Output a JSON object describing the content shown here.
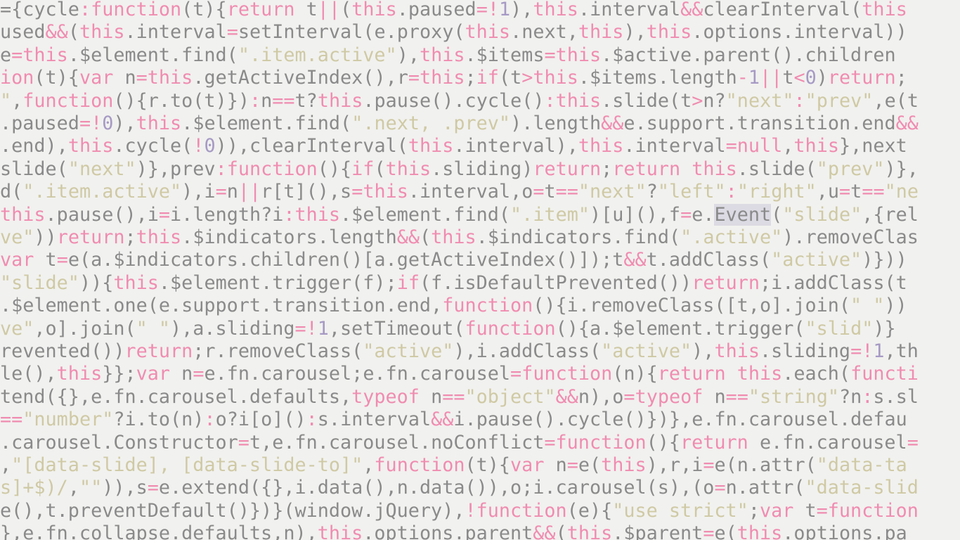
{
  "colors": {
    "background": "#f1f1ef",
    "plain": "#8a8a8a",
    "keyword": "#f08cb0",
    "string": "#cfc9a4",
    "number": "#a69ac4",
    "highlight": "#dcdae3"
  },
  "lines": [
    [
      [
        "p",
        "={cycle"
      ],
      [
        "k",
        ":function"
      ],
      [
        "p",
        "(t){"
      ],
      [
        "k",
        "return"
      ],
      [
        "p",
        " t"
      ],
      [
        "k",
        "||"
      ],
      [
        "p",
        "("
      ],
      [
        "k",
        "this"
      ],
      [
        "p",
        ".paused"
      ],
      [
        "k",
        "=!"
      ],
      [
        "n",
        "1"
      ],
      [
        "p",
        "),"
      ],
      [
        "k",
        "this"
      ],
      [
        "p",
        ".interval"
      ],
      [
        "k",
        "&&"
      ],
      [
        "p",
        "clearInterval("
      ],
      [
        "k",
        "this"
      ]
    ],
    [
      [
        "p",
        "used"
      ],
      [
        "k",
        "&&"
      ],
      [
        "p",
        "("
      ],
      [
        "k",
        "this"
      ],
      [
        "p",
        ".interval"
      ],
      [
        "k",
        "="
      ],
      [
        "p",
        "setInterval(e.proxy("
      ],
      [
        "k",
        "this"
      ],
      [
        "p",
        ".next,"
      ],
      [
        "k",
        "this"
      ],
      [
        "p",
        "),"
      ],
      [
        "k",
        "this"
      ],
      [
        "p",
        ".options.interval))"
      ]
    ],
    [
      [
        "p",
        "e"
      ],
      [
        "k",
        "=this"
      ],
      [
        "p",
        ".$element.find("
      ],
      [
        "s",
        "\".item.active\""
      ],
      [
        "p",
        "),"
      ],
      [
        "k",
        "this"
      ],
      [
        "p",
        ".$items"
      ],
      [
        "k",
        "=this"
      ],
      [
        "p",
        ".$active.parent().children"
      ]
    ],
    [
      [
        "k",
        "ion"
      ],
      [
        "p",
        "(t){"
      ],
      [
        "k",
        "var"
      ],
      [
        "p",
        " n"
      ],
      [
        "k",
        "=this"
      ],
      [
        "p",
        ".getActiveIndex(),r"
      ],
      [
        "k",
        "=this"
      ],
      [
        "p",
        ";"
      ],
      [
        "k",
        "if"
      ],
      [
        "p",
        "(t"
      ],
      [
        "k",
        ">this"
      ],
      [
        "p",
        ".$items.length"
      ],
      [
        "k",
        "-"
      ],
      [
        "n",
        "1"
      ],
      [
        "k",
        "||"
      ],
      [
        "p",
        "t"
      ],
      [
        "k",
        "<"
      ],
      [
        "n",
        "0"
      ],
      [
        "p",
        ")"
      ],
      [
        "k",
        "return"
      ],
      [
        "p",
        ";"
      ]
    ],
    [
      [
        "s",
        "\""
      ],
      [
        "p",
        ","
      ],
      [
        "k",
        "function"
      ],
      [
        "p",
        "(){r.to(t)})"
      ],
      [
        "k",
        ":"
      ],
      [
        "p",
        "n"
      ],
      [
        "k",
        "=="
      ],
      [
        "p",
        "t?"
      ],
      [
        "k",
        "this"
      ],
      [
        "p",
        ".pause().cycle()"
      ],
      [
        "k",
        ":this"
      ],
      [
        "p",
        ".slide(t"
      ],
      [
        "k",
        ">"
      ],
      [
        "p",
        "n?"
      ],
      [
        "s",
        "\"next\""
      ],
      [
        "k",
        ":"
      ],
      [
        "s",
        "\"prev\""
      ],
      [
        "p",
        ",e(t"
      ]
    ],
    [
      [
        "p",
        ".paused"
      ],
      [
        "k",
        "=!"
      ],
      [
        "n",
        "0"
      ],
      [
        "p",
        "),"
      ],
      [
        "k",
        "this"
      ],
      [
        "p",
        ".$element.find("
      ],
      [
        "s",
        "\".next, .prev\""
      ],
      [
        "p",
        ").length"
      ],
      [
        "k",
        "&&"
      ],
      [
        "p",
        "e.support.transition.end"
      ],
      [
        "k",
        "&&"
      ]
    ],
    [
      [
        "p",
        ".end),"
      ],
      [
        "k",
        "this"
      ],
      [
        "p",
        ".cycle("
      ],
      [
        "k",
        "!"
      ],
      [
        "n",
        "0"
      ],
      [
        "p",
        ")),clearInterval("
      ],
      [
        "k",
        "this"
      ],
      [
        "p",
        ".interval),"
      ],
      [
        "k",
        "this"
      ],
      [
        "p",
        ".interval"
      ],
      [
        "k",
        "=null"
      ],
      [
        "p",
        ","
      ],
      [
        "k",
        "this"
      ],
      [
        "p",
        "},next"
      ]
    ],
    [
      [
        "p",
        "slide("
      ],
      [
        "s",
        "\"next\""
      ],
      [
        "p",
        ")},prev"
      ],
      [
        "k",
        ":function"
      ],
      [
        "p",
        "(){"
      ],
      [
        "k",
        "if"
      ],
      [
        "p",
        "("
      ],
      [
        "k",
        "this"
      ],
      [
        "p",
        ".sliding)"
      ],
      [
        "k",
        "return"
      ],
      [
        "p",
        ";"
      ],
      [
        "k",
        "return this"
      ],
      [
        "p",
        ".slide("
      ],
      [
        "s",
        "\"prev\""
      ],
      [
        "p",
        ")},"
      ]
    ],
    [
      [
        "p",
        "d("
      ],
      [
        "s",
        "\".item.active\""
      ],
      [
        "p",
        "),i"
      ],
      [
        "k",
        "="
      ],
      [
        "p",
        "n"
      ],
      [
        "k",
        "||"
      ],
      [
        "p",
        "r[t](),s"
      ],
      [
        "k",
        "=this"
      ],
      [
        "p",
        ".interval,o"
      ],
      [
        "k",
        "="
      ],
      [
        "p",
        "t"
      ],
      [
        "k",
        "=="
      ],
      [
        "s",
        "\"next\""
      ],
      [
        "p",
        "?"
      ],
      [
        "s",
        "\"left\""
      ],
      [
        "k",
        ":"
      ],
      [
        "s",
        "\"right\""
      ],
      [
        "p",
        ",u"
      ],
      [
        "k",
        "="
      ],
      [
        "p",
        "t"
      ],
      [
        "k",
        "=="
      ],
      [
        "s",
        "\"ne"
      ]
    ],
    [
      [
        "k",
        "this"
      ],
      [
        "p",
        ".pause(),i"
      ],
      [
        "k",
        "="
      ],
      [
        "p",
        "i.length?i"
      ],
      [
        "k",
        ":this"
      ],
      [
        "p",
        ".$element.find("
      ],
      [
        "s",
        "\".item\""
      ],
      [
        "p",
        ")[u](),f"
      ],
      [
        "k",
        "="
      ],
      [
        "p",
        "e."
      ],
      [
        "h",
        "Event"
      ],
      [
        "p",
        "("
      ],
      [
        "s",
        "\"slide\""
      ],
      [
        "p",
        ",{rel"
      ]
    ],
    [
      [
        "s",
        "ve\""
      ],
      [
        "p",
        "))"
      ],
      [
        "k",
        "return"
      ],
      [
        "p",
        ";"
      ],
      [
        "k",
        "this"
      ],
      [
        "p",
        ".$indicators.length"
      ],
      [
        "k",
        "&&"
      ],
      [
        "p",
        "("
      ],
      [
        "k",
        "this"
      ],
      [
        "p",
        ".$indicators.find("
      ],
      [
        "s",
        "\".active\""
      ],
      [
        "p",
        ").removeClas"
      ]
    ],
    [
      [
        "k",
        "var"
      ],
      [
        "p",
        " t"
      ],
      [
        "k",
        "="
      ],
      [
        "p",
        "e(a.$indicators.children()[a.getActiveIndex()]);t"
      ],
      [
        "k",
        "&&"
      ],
      [
        "p",
        "t.addClass("
      ],
      [
        "s",
        "\"active\""
      ],
      [
        "p",
        ")}))"
      ]
    ],
    [
      [
        "s",
        "\"slide\""
      ],
      [
        "p",
        "))"
      ],
      [
        "p",
        "{"
      ],
      [
        "k",
        "this"
      ],
      [
        "p",
        ".$element.trigger(f);"
      ],
      [
        "k",
        "if"
      ],
      [
        "p",
        "(f.isDefaultPrevented())"
      ],
      [
        "k",
        "return"
      ],
      [
        "p",
        ";i.addClass(t"
      ]
    ],
    [
      [
        "p",
        ".$element.one(e.support.transition.end,"
      ],
      [
        "k",
        "function"
      ],
      [
        "p",
        "(){i.removeClass([t,o].join("
      ],
      [
        "s",
        "\" \""
      ],
      [
        "p",
        "))"
      ]
    ],
    [
      [
        "s",
        "ve\""
      ],
      [
        "p",
        ",o].join("
      ],
      [
        "s",
        "\" \""
      ],
      [
        "p",
        "),a.sliding"
      ],
      [
        "k",
        "=!"
      ],
      [
        "n",
        "1"
      ],
      [
        "p",
        ",setTimeout("
      ],
      [
        "k",
        "function"
      ],
      [
        "p",
        "(){a.$element.trigger("
      ],
      [
        "s",
        "\"slid\""
      ],
      [
        "p",
        ")}"
      ]
    ],
    [
      [
        "p",
        "revented())"
      ],
      [
        "k",
        "return"
      ],
      [
        "p",
        ";r.removeClass("
      ],
      [
        "s",
        "\"active\""
      ],
      [
        "p",
        "),i.addClass("
      ],
      [
        "s",
        "\"active\""
      ],
      [
        "p",
        "),"
      ],
      [
        "k",
        "this"
      ],
      [
        "p",
        ".sliding"
      ],
      [
        "k",
        "=!"
      ],
      [
        "n",
        "1"
      ],
      [
        "p",
        ",th"
      ]
    ],
    [
      [
        "p",
        "le(),"
      ],
      [
        "k",
        "this"
      ],
      [
        "p",
        "}};"
      ],
      [
        "k",
        "var"
      ],
      [
        "p",
        " n"
      ],
      [
        "k",
        "="
      ],
      [
        "p",
        "e.fn.carousel;e.fn.carousel"
      ],
      [
        "k",
        "=function"
      ],
      [
        "p",
        "(n){"
      ],
      [
        "k",
        "return this"
      ],
      [
        "p",
        ".each("
      ],
      [
        "k",
        "functi"
      ]
    ],
    [
      [
        "p",
        "tend({},e.fn.carousel.defaults,"
      ],
      [
        "k",
        "typeof"
      ],
      [
        "p",
        " n"
      ],
      [
        "k",
        "=="
      ],
      [
        "s",
        "\"object\""
      ],
      [
        "k",
        "&&"
      ],
      [
        "p",
        "n),o"
      ],
      [
        "k",
        "=typeof"
      ],
      [
        "p",
        " n"
      ],
      [
        "k",
        "=="
      ],
      [
        "s",
        "\"string\""
      ],
      [
        "p",
        "?n"
      ],
      [
        "k",
        ":"
      ],
      [
        "p",
        "s.sl"
      ]
    ],
    [
      [
        "k",
        "=="
      ],
      [
        "s",
        "\"number\""
      ],
      [
        "p",
        "?i.to(n)"
      ],
      [
        "k",
        ":"
      ],
      [
        "p",
        "o?i[o]()"
      ],
      [
        "k",
        ":"
      ],
      [
        "p",
        "s.interval"
      ],
      [
        "k",
        "&&"
      ],
      [
        "p",
        "i.pause().cycle()})},e.fn.carousel.defau"
      ]
    ],
    [
      [
        "p",
        ".carousel.Constructor"
      ],
      [
        "k",
        "="
      ],
      [
        "p",
        "t,e.fn.carousel.noConflict"
      ],
      [
        "k",
        "=function"
      ],
      [
        "p",
        "(){"
      ],
      [
        "k",
        "return"
      ],
      [
        "p",
        " e.fn.carousel"
      ],
      [
        "k",
        "="
      ]
    ],
    [
      [
        "p",
        ","
      ],
      [
        "s",
        "\"[data-slide], [data-slide-to]\""
      ],
      [
        "p",
        ","
      ],
      [
        "k",
        "function"
      ],
      [
        "p",
        "(t){"
      ],
      [
        "k",
        "var"
      ],
      [
        "p",
        " n"
      ],
      [
        "k",
        "="
      ],
      [
        "p",
        "e("
      ],
      [
        "k",
        "this"
      ],
      [
        "p",
        "),r,i"
      ],
      [
        "k",
        "="
      ],
      [
        "p",
        "e(n.attr("
      ],
      [
        "s",
        "\"data-ta"
      ]
    ],
    [
      [
        "s",
        "s]+$)/"
      ],
      [
        "p",
        ","
      ],
      [
        "s",
        "\"\""
      ],
      [
        "p",
        ")),s"
      ],
      [
        "k",
        "="
      ],
      [
        "p",
        "e.extend({},i.data(),n.data()),o;i.carousel(s),(o"
      ],
      [
        "k",
        "="
      ],
      [
        "p",
        "n.attr("
      ],
      [
        "s",
        "\"data-slid"
      ]
    ],
    [
      [
        "p",
        "e(),t.preventDefault()})}(window.jQuery),"
      ],
      [
        "k",
        "!function"
      ],
      [
        "p",
        "(e){"
      ],
      [
        "s",
        "\"use strict\""
      ],
      [
        "p",
        ";"
      ],
      [
        "k",
        "var"
      ],
      [
        "p",
        " t"
      ],
      [
        "k",
        "=function"
      ]
    ],
    [
      [
        "p",
        "},e.fn.collapse.defaults,n),"
      ],
      [
        "k",
        "this"
      ],
      [
        "p",
        ".options.parent"
      ],
      [
        "k",
        "&&"
      ],
      [
        "p",
        "("
      ],
      [
        "k",
        "this"
      ],
      [
        "p",
        ".$parent"
      ],
      [
        "k",
        "="
      ],
      [
        "p",
        "e("
      ],
      [
        "k",
        "this"
      ],
      [
        "p",
        ".options.pa"
      ]
    ]
  ]
}
